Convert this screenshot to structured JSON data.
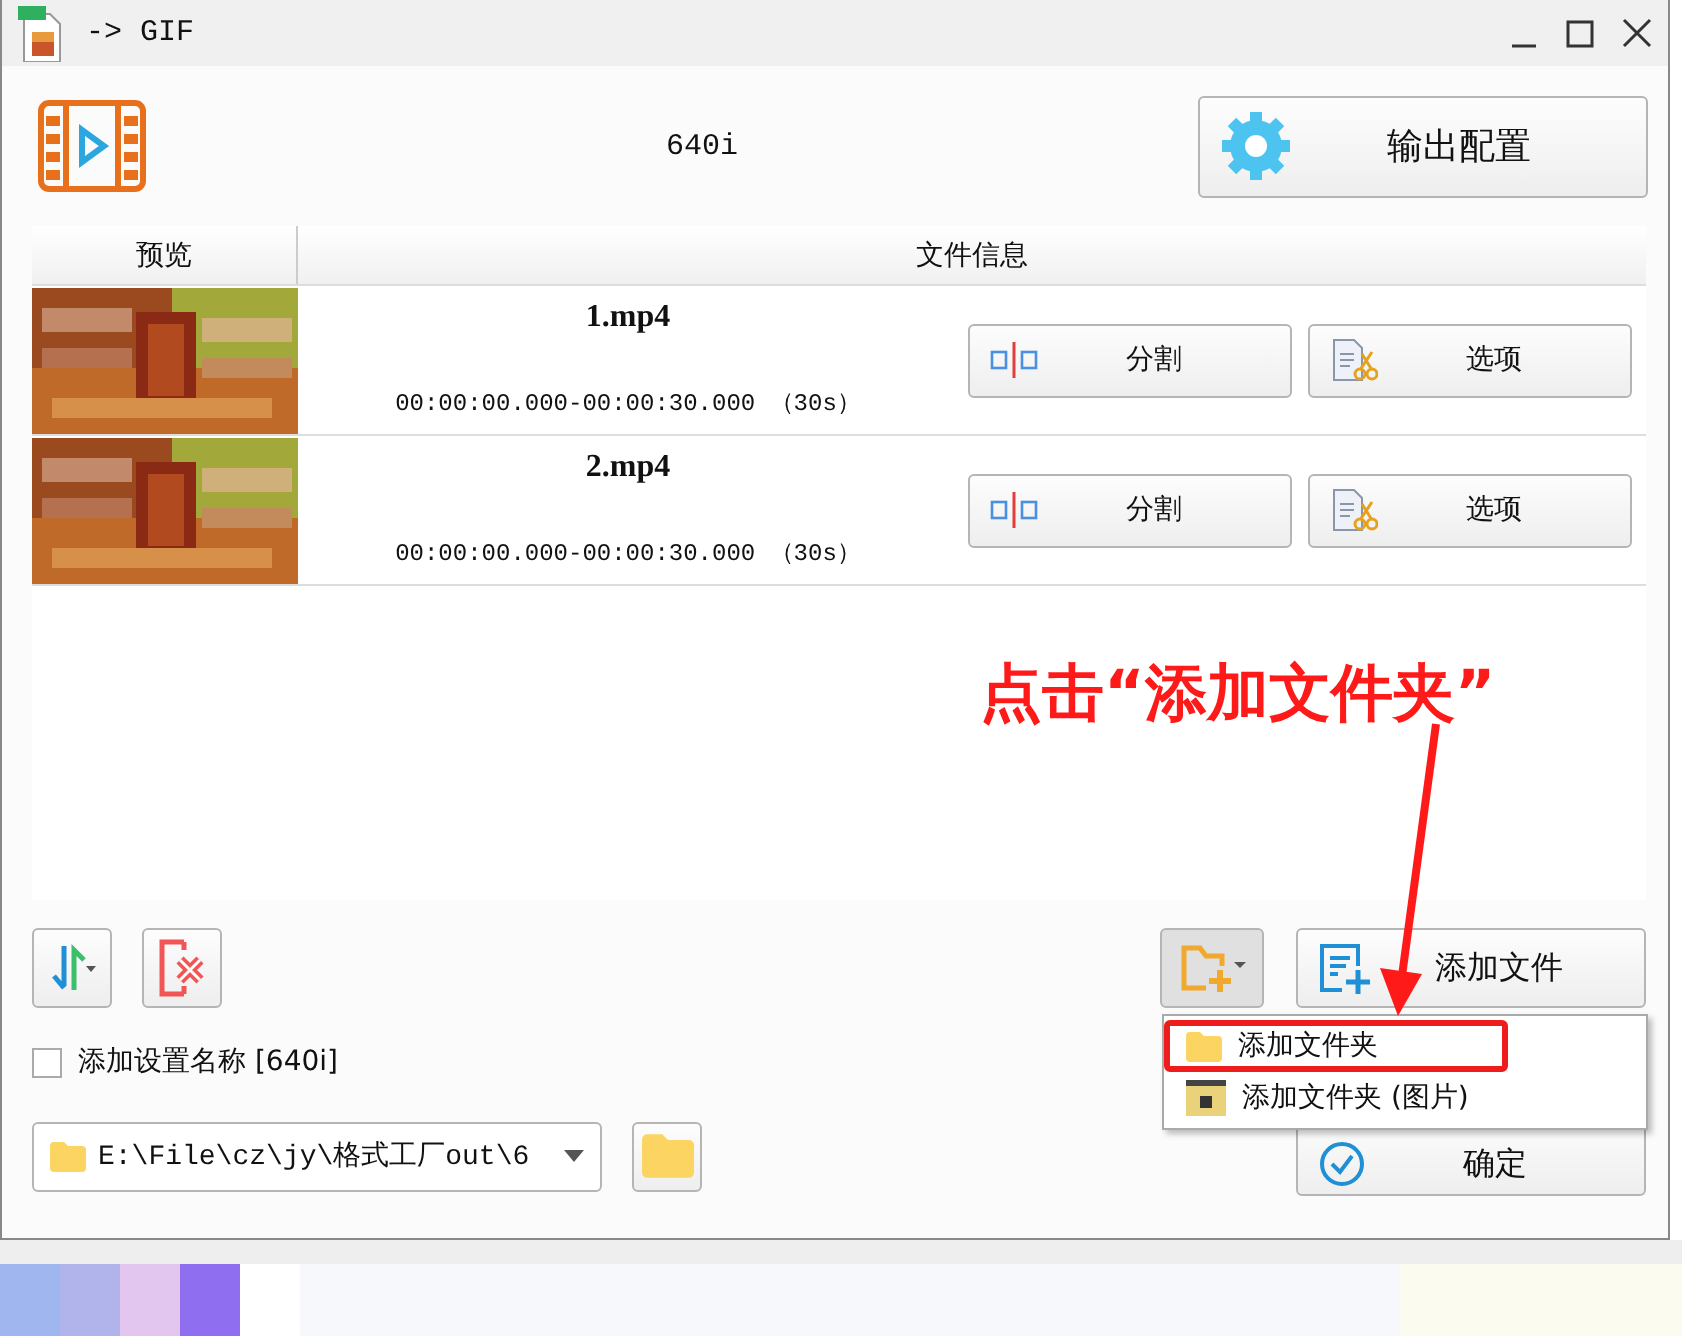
{
  "window": {
    "title": "-> GIF"
  },
  "header": {
    "preset": "640i",
    "config_button": "输出配置"
  },
  "table": {
    "columns": [
      "预览",
      "文件信息"
    ],
    "rows": [
      {
        "name": "1.mp4",
        "range": "00:00:00.000-00:00:30.000 （30s）",
        "split_button": "分割",
        "options_button": "选项"
      },
      {
        "name": "2.mp4",
        "range": "00:00:00.000-00:00:30.000 （30s）",
        "split_button": "分割",
        "options_button": "选项"
      }
    ]
  },
  "add_file_button": "添加文件",
  "name_option": {
    "label": "添加设置名称 [640i]",
    "checked": false
  },
  "output_path": {
    "value": "E:\\File\\cz\\jy\\格式工厂out\\6"
  },
  "confirm_button": "确定",
  "menu": {
    "items": [
      {
        "label": "添加文件夹",
        "kind": "folder",
        "highlighted": true
      },
      {
        "label": "添加文件夹 (图片)",
        "kind": "image-folder",
        "highlighted": false
      }
    ]
  },
  "annotation": {
    "text": "点击“添加文件夹”"
  }
}
